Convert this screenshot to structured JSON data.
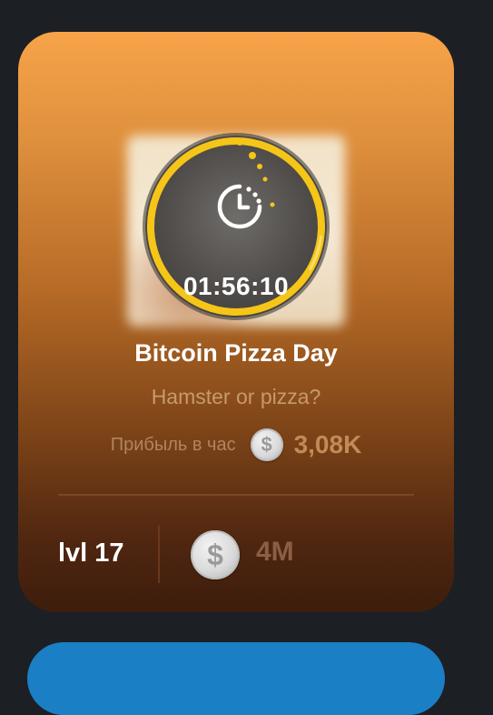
{
  "card": {
    "timer": "01:56:10",
    "title": "Bitcoin Pizza Day",
    "subtitle": "Hamster or pizza?",
    "profit_label": "Прибыль в час",
    "profit_value": "3,08K",
    "level": "lvl 17",
    "cost": "4M",
    "coin_symbol": "$",
    "icons": {
      "timer": "stopwatch-icon",
      "coin": "coin-icon"
    },
    "colors": {
      "gradient_top": "#f7a349",
      "gradient_bottom": "#3d1d0c",
      "ring": "#f5c518",
      "next_card": "#1b7fc6"
    }
  }
}
